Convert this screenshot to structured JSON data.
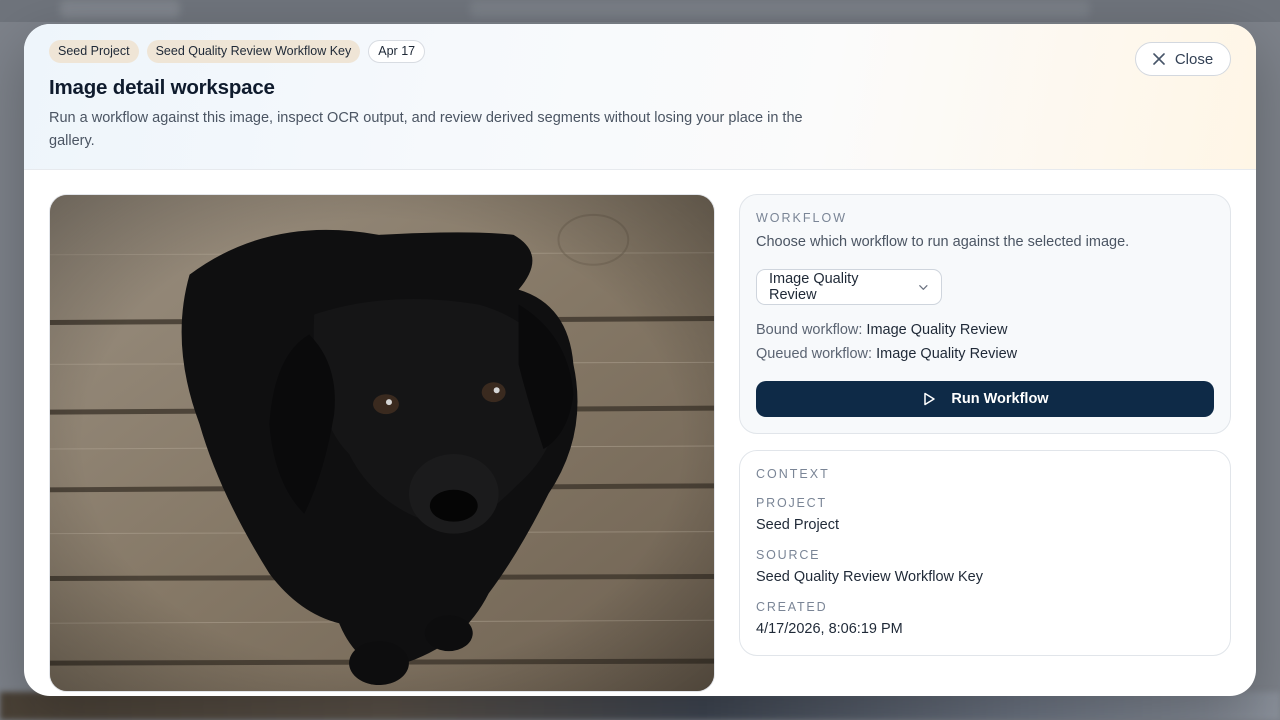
{
  "header": {
    "chips": [
      "Seed Project",
      "Seed Quality Review Workflow Key",
      "Apr 17"
    ],
    "title": "Image detail workspace",
    "subtitle": "Run a workflow against this image, inspect OCR output, and review derived segments without losing your place in the gallery.",
    "close_label": "Close"
  },
  "image": {
    "subject": "black puppy on wooden floor"
  },
  "workflow": {
    "section_label": "WORKFLOW",
    "description": "Choose which workflow to run against the selected image.",
    "selected": "Image Quality Review",
    "bound_label": "Bound workflow:",
    "bound_value": "Image Quality Review",
    "queued_label": "Queued workflow:",
    "queued_value": "Image Quality Review",
    "run_label": "Run Workflow"
  },
  "context": {
    "section_label": "CONTEXT",
    "project_label": "PROJECT",
    "project_value": "Seed Project",
    "source_label": "SOURCE",
    "source_value": "Seed Quality Review Workflow Key",
    "created_label": "CREATED",
    "created_value": "4/17/2026, 8:06:19 PM"
  },
  "colors": {
    "primary_button": "#0e2a47",
    "chip_tan": "#efe5d6",
    "label_muted": "#7a8596"
  },
  "icons": {
    "close": "close-icon",
    "dropdown": "chevron-down-icon",
    "run": "play-icon"
  }
}
